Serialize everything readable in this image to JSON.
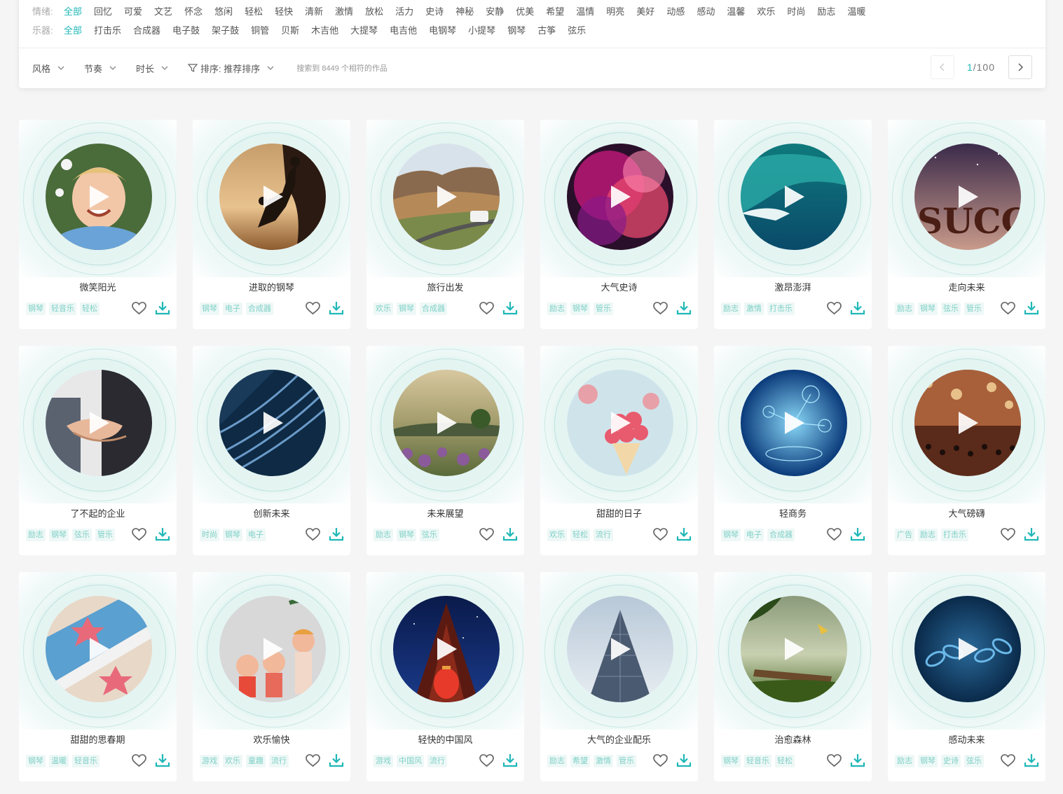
{
  "filters": {
    "mood_label": "情绪:",
    "mood_options": [
      "全部",
      "回忆",
      "可爱",
      "文艺",
      "怀念",
      "悠闲",
      "轻松",
      "轻快",
      "清新",
      "激情",
      "放松",
      "活力",
      "史诗",
      "神秘",
      "安静",
      "优美",
      "希望",
      "温情",
      "明亮",
      "美好",
      "动感",
      "感动",
      "温馨",
      "欢乐",
      "时尚",
      "励志",
      "温暖"
    ],
    "instrument_label": "乐器:",
    "instrument_options": [
      "全部",
      "打击乐",
      "合成器",
      "电子鼓",
      "架子鼓",
      "铜管",
      "贝斯",
      "木吉他",
      "大提琴",
      "电吉他",
      "电钢琴",
      "小提琴",
      "钢琴",
      "古筝",
      "弦乐"
    ]
  },
  "toolbar": {
    "style_label": "风格",
    "tempo_label": "节奏",
    "duration_label": "时长",
    "sort_label": "排序: 推荐排序",
    "result_text": "搜索到 8449 个相符的作品"
  },
  "pager": {
    "current": "1",
    "total": "/100"
  },
  "accent_color": "#1fb7b7",
  "cards": [
    {
      "title": "微笑阳光",
      "tags": [
        "钢琴",
        "轻音乐",
        "轻松"
      ],
      "cover": "boy-smiling"
    },
    {
      "title": "进取的钢琴",
      "tags": [
        "钢琴",
        "电子",
        "合成器"
      ],
      "cover": "climbers-sunset"
    },
    {
      "title": "旅行出发",
      "tags": [
        "欢乐",
        "钢琴",
        "合成器"
      ],
      "cover": "mountain-road"
    },
    {
      "title": "大气史诗",
      "tags": [
        "励志",
        "钢琴",
        "管乐"
      ],
      "cover": "color-smoke"
    },
    {
      "title": "激昂澎湃",
      "tags": [
        "励志",
        "激情",
        "打击乐"
      ],
      "cover": "ocean-wave"
    },
    {
      "title": "走向未来",
      "tags": [
        "励志",
        "钢琴",
        "弦乐",
        "管乐"
      ],
      "cover": "success-letters"
    },
    {
      "title": "了不起的企业",
      "tags": [
        "励志",
        "钢琴",
        "弦乐",
        "管乐"
      ],
      "cover": "handshake"
    },
    {
      "title": "创新未来",
      "tags": [
        "时尚",
        "钢琴",
        "电子"
      ],
      "cover": "building-lines"
    },
    {
      "title": "未来展望",
      "tags": [
        "励志",
        "钢琴",
        "弦乐"
      ],
      "cover": "meadow"
    },
    {
      "title": "甜甜的日子",
      "tags": [
        "欢乐",
        "轻松",
        "流行"
      ],
      "cover": "cupcakes"
    },
    {
      "title": "轻商务",
      "tags": [
        "钢琴",
        "电子",
        "合成器"
      ],
      "cover": "tech-hologram"
    },
    {
      "title": "大气磅礴",
      "tags": [
        "广告",
        "励志",
        "打击乐"
      ],
      "cover": "concert-hall"
    },
    {
      "title": "甜甜的思春期",
      "tags": [
        "钢琴",
        "温暖",
        "轻音乐"
      ],
      "cover": "starfish"
    },
    {
      "title": "欢乐愉快",
      "tags": [
        "游戏",
        "欢乐",
        "童趣",
        "流行"
      ],
      "cover": "cartoon-kids"
    },
    {
      "title": "轻快的中国风",
      "tags": [
        "游戏",
        "中国风",
        "流行"
      ],
      "cover": "lantern-pagoda"
    },
    {
      "title": "大气的企业配乐",
      "tags": [
        "励志",
        "希望",
        "激情",
        "管乐"
      ],
      "cover": "skyscraper"
    },
    {
      "title": "治愈森林",
      "tags": [
        "钢琴",
        "轻音乐",
        "轻松"
      ],
      "cover": "forest-log"
    },
    {
      "title": "感动未来",
      "tags": [
        "励志",
        "钢琴",
        "史诗",
        "弦乐"
      ],
      "cover": "digital-chain"
    }
  ]
}
